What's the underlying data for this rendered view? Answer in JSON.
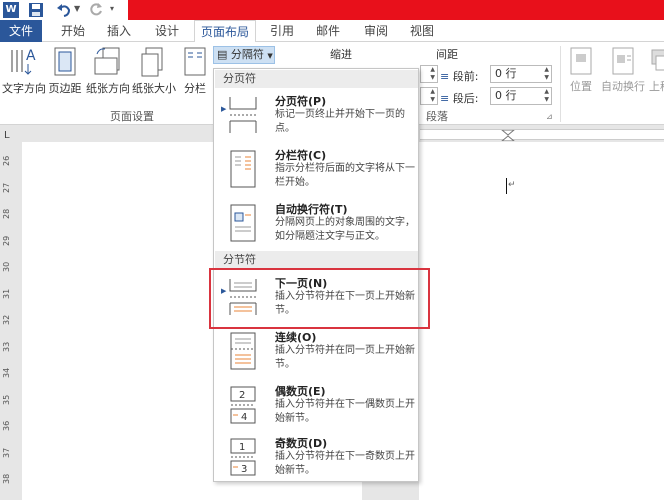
{
  "quick_access": {
    "word_letter": "W"
  },
  "tabs": [
    {
      "label": "文件"
    },
    {
      "label": "开始"
    },
    {
      "label": "插入"
    },
    {
      "label": "设计"
    },
    {
      "label": "页面布局"
    },
    {
      "label": "引用"
    },
    {
      "label": "邮件"
    },
    {
      "label": "审阅"
    },
    {
      "label": "视图"
    }
  ],
  "ribbon": {
    "text_direction": "文字方向",
    "margins": "页边距",
    "orientation": "纸张方向",
    "size": "纸张大小",
    "columns": "分栏",
    "breaks": "分隔符",
    "page_setup_group": "页面设置",
    "indent": "缩进",
    "spacing": "间距",
    "before_label": "段前:",
    "before_value": "0 行",
    "after_label": "段后:",
    "after_value": "0 行",
    "paragraph_group": "段落",
    "position": "位置",
    "wrap_text": "自动换行",
    "bring_forward": "上移"
  },
  "ruler": {
    "numbers": [
      "26",
      "27",
      "28",
      "29",
      "30",
      "31",
      "32",
      "33",
      "34",
      "35",
      "36",
      "37",
      "38"
    ],
    "corner": "L"
  },
  "menu": {
    "page_breaks_header": "分页符",
    "section_breaks_header": "分节符",
    "items": [
      {
        "title": "分页符(P)",
        "desc": "标记一页终止并开始下一页的点。"
      },
      {
        "title": "分栏符(C)",
        "desc": "指示分栏符后面的文字将从下一栏开始。"
      },
      {
        "title": "自动换行符(T)",
        "desc": "分隔网页上的对象周围的文字，如分隔题注文字与正文。"
      },
      {
        "title": "下一页(N)",
        "desc": "插入分节符并在下一页上开始新节。"
      },
      {
        "title": "连续(O)",
        "desc": "插入分节符并在同一页上开始新节。"
      },
      {
        "title": "偶数页(E)",
        "desc": "插入分节符并在下一偶数页上开始新节。"
      },
      {
        "title": "奇数页(D)",
        "desc": "插入分节符并在下一奇数页上开始新节。"
      }
    ],
    "even_icon_digits": [
      "2",
      "4"
    ],
    "odd_icon_digits": [
      "1",
      "3"
    ]
  },
  "colors": {
    "title_red": "#e8101b",
    "word_blue": "#2b579a",
    "highlight_red": "#d9343f",
    "accent_orange": "#e8843a"
  }
}
